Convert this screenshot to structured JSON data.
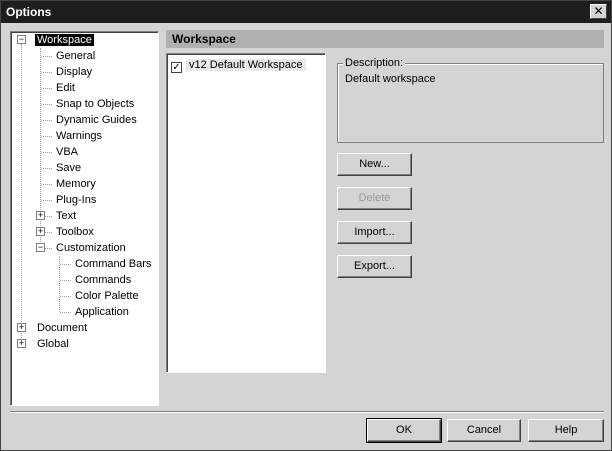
{
  "window": {
    "title": "Options",
    "close_glyph": "✕"
  },
  "tree": {
    "items": [
      {
        "label": "Workspace",
        "level": 0,
        "expander": "−",
        "selected": true
      },
      {
        "label": "General",
        "level": 1
      },
      {
        "label": "Display",
        "level": 1
      },
      {
        "label": "Edit",
        "level": 1
      },
      {
        "label": "Snap to Objects",
        "level": 1
      },
      {
        "label": "Dynamic Guides",
        "level": 1
      },
      {
        "label": "Warnings",
        "level": 1
      },
      {
        "label": "VBA",
        "level": 1
      },
      {
        "label": "Save",
        "level": 1
      },
      {
        "label": "Memory",
        "level": 1
      },
      {
        "label": "Plug-Ins",
        "level": 1
      },
      {
        "label": "Text",
        "level": 1,
        "expander": "+"
      },
      {
        "label": "Toolbox",
        "level": 1,
        "expander": "+"
      },
      {
        "label": "Customization",
        "level": 1,
        "expander": "−"
      },
      {
        "label": "Command Bars",
        "level": 2
      },
      {
        "label": "Commands",
        "level": 2
      },
      {
        "label": "Color Palette",
        "level": 2
      },
      {
        "label": "Application",
        "level": 2
      },
      {
        "label": "Document",
        "level": 0,
        "expander": "+"
      },
      {
        "label": "Global",
        "level": 0,
        "expander": "+"
      }
    ]
  },
  "panel": {
    "header": "Workspace",
    "workspace_item": {
      "label": "v12 Default Workspace",
      "checked": true,
      "check_glyph": "✓"
    },
    "description_label": "Description:",
    "description_text": "Default workspace",
    "new_button": "New...",
    "delete_button": "Delete",
    "import_button": "Import...",
    "export_button": "Export..."
  },
  "footer": {
    "ok": "OK",
    "cancel": "Cancel",
    "help": "Help"
  }
}
